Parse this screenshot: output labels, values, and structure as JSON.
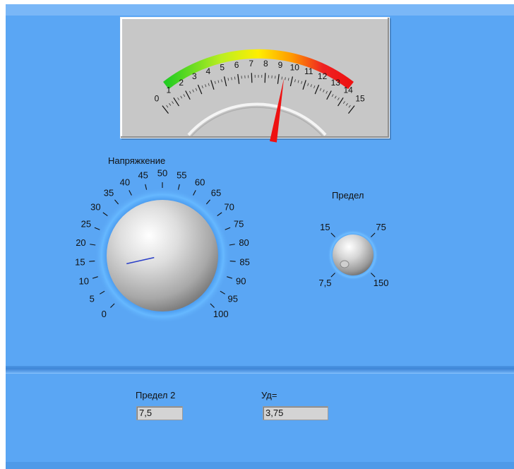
{
  "meter": {
    "scale_labels": [
      "0",
      "1",
      "2",
      "3",
      "4",
      "5",
      "6",
      "7",
      "8",
      "9",
      "10",
      "11",
      "12",
      "13",
      "14",
      "15"
    ],
    "value": 9.4,
    "min": 0,
    "max": 15,
    "colors": [
      "#22cc22",
      "#ccee22",
      "#ffee00",
      "#ff9900",
      "#ee2222"
    ],
    "needle_color": "#ee1111"
  },
  "voltage_knob": {
    "label": "Напряжкение",
    "scale_labels": [
      "0",
      "5",
      "10",
      "15",
      "20",
      "25",
      "30",
      "35",
      "40",
      "45",
      "50",
      "55",
      "60",
      "65",
      "70",
      "75",
      "80",
      "85",
      "90",
      "95",
      "100"
    ],
    "value": 12,
    "min": 0,
    "max": 100
  },
  "limit_knob": {
    "label": "Предел",
    "scale_labels": [
      "7,5",
      "15",
      "75",
      "150"
    ],
    "value": "7,5"
  },
  "indicators": {
    "limit2": {
      "label": "Предел 2",
      "value": "7,5"
    },
    "ud": {
      "label": "Уд=",
      "value": "3,75"
    }
  },
  "colors": {
    "panel": "#5aa6f4",
    "indicator_bg": "#d4d4d4"
  }
}
